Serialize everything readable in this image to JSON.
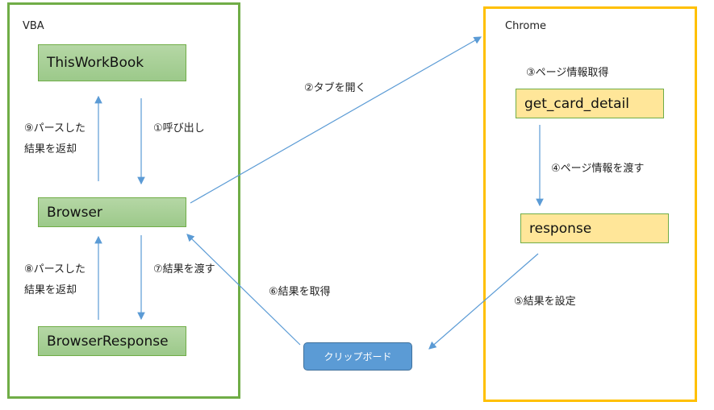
{
  "colors": {
    "vba_frame": "#70ad47",
    "chrome_frame": "#ffc000",
    "arrow": "#5b9bd5",
    "clipboard": "#5b9bd5"
  },
  "vba": {
    "title": "VBA",
    "boxes": [
      "ThisWorkBook",
      "Browser",
      "BrowserResponse"
    ],
    "step1": "①呼び出し",
    "step9_line1": "⑨パースした",
    "step9_line2": "結果を返却",
    "step7": "⑦結果を渡す",
    "step8_line1": "⑧パースした",
    "step8_line2": "結果を返却"
  },
  "chrome": {
    "title": "Chrome",
    "boxes": [
      "get_card_detail",
      "response"
    ],
    "step3": "③ページ情報取得",
    "step4": "④ページ情報を渡す",
    "step5": "⑤結果を設定"
  },
  "middle": {
    "step2": "②タブを開く",
    "step6": "⑥結果を取得",
    "clipboard": "クリップボード"
  }
}
